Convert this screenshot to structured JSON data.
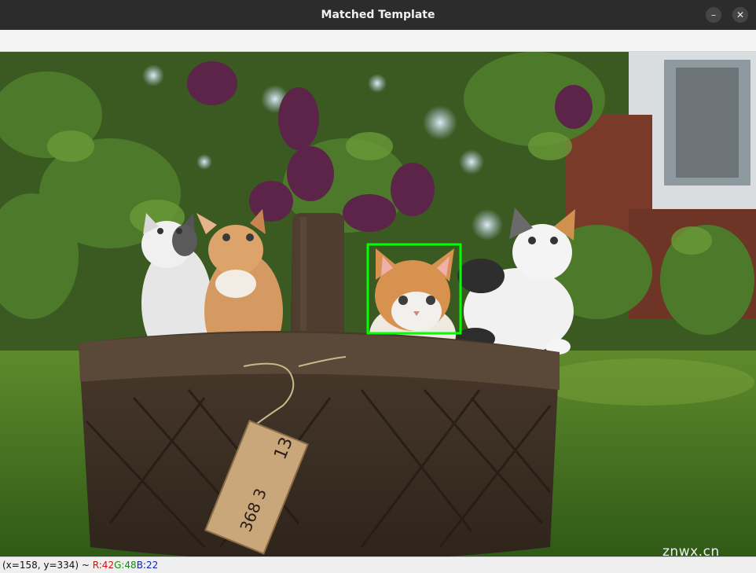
{
  "window": {
    "title": "Matched Template",
    "minimize_glyph": "–",
    "close_glyph": "✕"
  },
  "image": {
    "subject": "five kittens in a woven basket on grass",
    "match_box_color": "#00ff00",
    "tag_text_top": "13",
    "tag_text_bottom": "368 3"
  },
  "status": {
    "coords": "(x=158, y=334) ~ ",
    "r": "R:42",
    "g": "G:48",
    "b": "B:22"
  },
  "watermark": "znwx.cn"
}
